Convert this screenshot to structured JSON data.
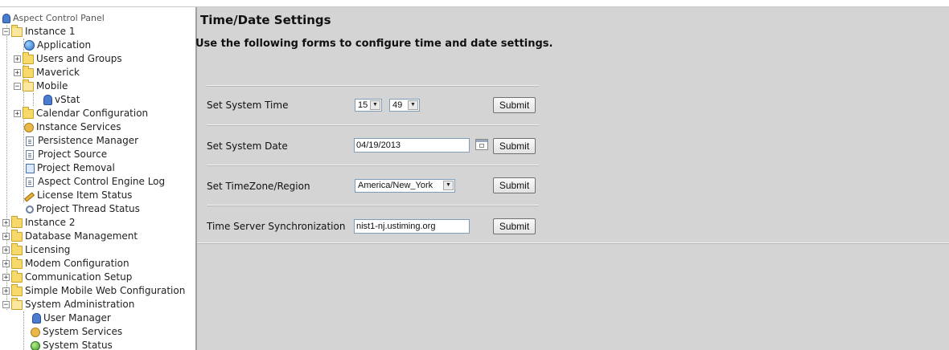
{
  "sidebar": {
    "items": [
      {
        "label": "Aspect Control Panel"
      },
      {
        "label": "Instance 1"
      },
      {
        "label": "Application"
      },
      {
        "label": "Users and Groups"
      },
      {
        "label": "Maverick"
      },
      {
        "label": "Mobile"
      },
      {
        "label": "vStat"
      },
      {
        "label": "Calendar Configuration"
      },
      {
        "label": "Instance Services"
      },
      {
        "label": "Persistence Manager"
      },
      {
        "label": "Project Source"
      },
      {
        "label": "Project Removal"
      },
      {
        "label": "Aspect Control Engine Log"
      },
      {
        "label": "License Item Status"
      },
      {
        "label": "Project Thread Status"
      },
      {
        "label": "Instance 2"
      },
      {
        "label": "Database Management"
      },
      {
        "label": "Licensing"
      },
      {
        "label": "Modem Configuration"
      },
      {
        "label": "Communication Setup"
      },
      {
        "label": "Simple Mobile Web Configuration"
      },
      {
        "label": "System Administration"
      },
      {
        "label": "User Manager"
      },
      {
        "label": "System Services"
      },
      {
        "label": "System Status"
      }
    ]
  },
  "main": {
    "title": "Time/Date Settings",
    "subtitle": "Use the following forms to configure time and date settings.",
    "time": {
      "label": "Set System Time",
      "hour": "15",
      "minute": "49",
      "submit": "Submit"
    },
    "date": {
      "label": "Set System Date",
      "value": "04/19/2013",
      "submit": "Submit"
    },
    "timezone": {
      "label": "Set TimeZone/Region",
      "value": "America/New_York",
      "submit": "Submit"
    },
    "timeserver": {
      "label": "Time Server Synchronization",
      "value": "nist1-nj.ustiming.org",
      "submit": "Submit"
    }
  }
}
